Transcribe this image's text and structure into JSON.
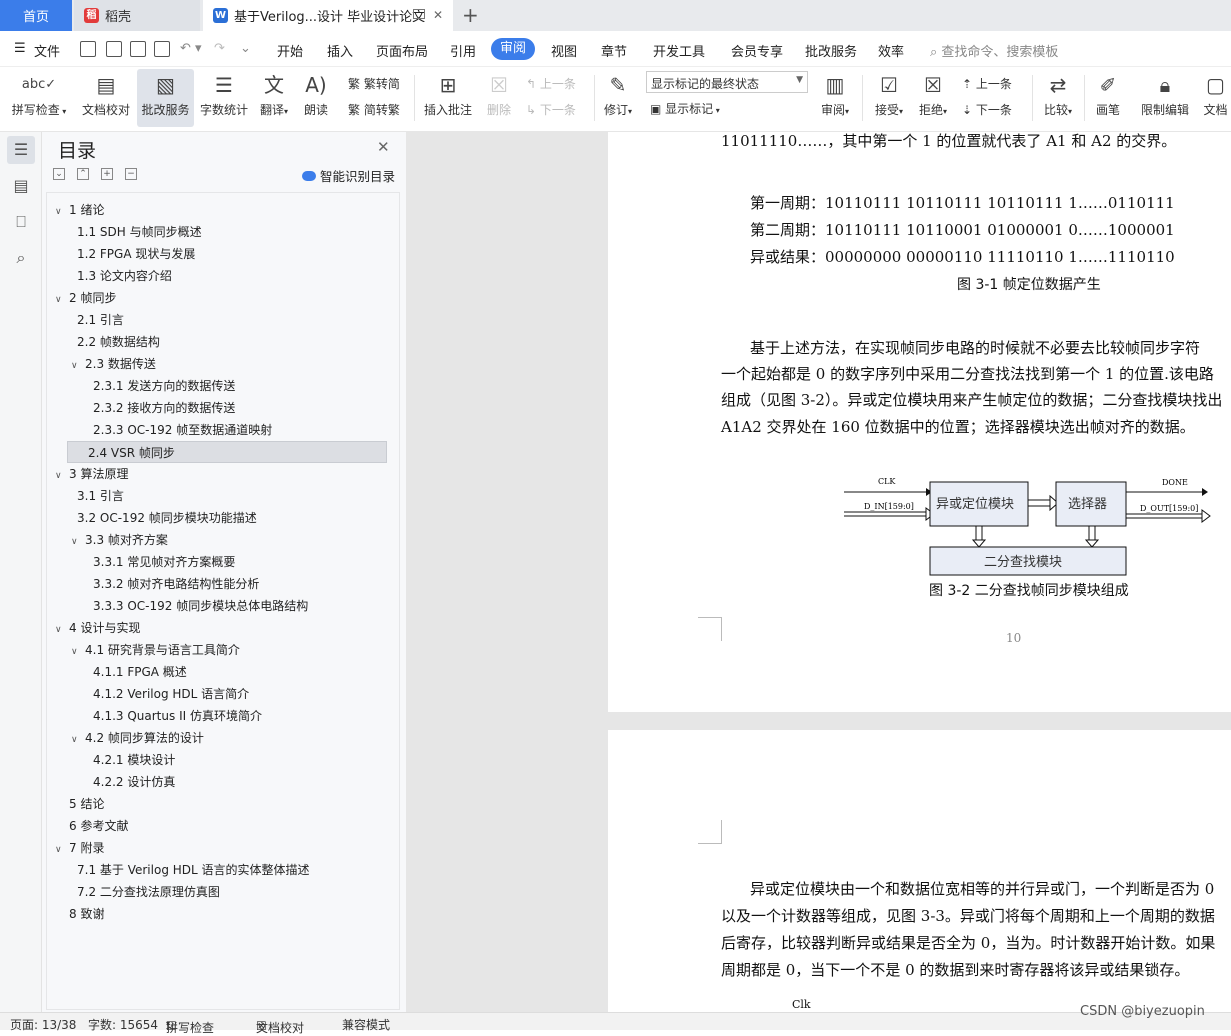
{
  "tabs": {
    "home": "首页",
    "daoke": "稻壳",
    "doc": "基于Verilog...设计 毕业设计论文"
  },
  "menu": {
    "file": "文件",
    "items": [
      "开始",
      "插入",
      "页面布局",
      "引用",
      "审阅",
      "视图",
      "章节",
      "开发工具",
      "会员专享",
      "批改服务",
      "效率"
    ],
    "active": "审阅",
    "search": "查找命令、搜索模板"
  },
  "ribbon": {
    "spell": "拼写检查",
    "proof": "文档校对",
    "correct": "批改服务",
    "wordcount": "字数统计",
    "translate": "翻译",
    "read": "朗读",
    "trad": "繁转简",
    "simp": "简转繁",
    "insert_comment": "插入批注",
    "delete": "删除",
    "prev": "上一条",
    "next": "下一条",
    "revise": "修订",
    "markup_state": "显示标记的最终状态",
    "show_markup": "显示标记",
    "review": "审阅",
    "accept": "接受",
    "reject": "拒绝",
    "prev2": "上一条",
    "next2": "下一条",
    "compare": "比较",
    "pen": "画笔",
    "restrict": "限制编辑",
    "docright": "文档"
  },
  "toc": {
    "title": "目录",
    "smart": "智能识别目录",
    "items": [
      {
        "label": "1  绪论",
        "level": 1,
        "arrow": true
      },
      {
        "label": "1.1 SDH 与帧同步概述",
        "level": 2,
        "arrow": false
      },
      {
        "label": "1.2 FPGA 现状与发展",
        "level": 2,
        "arrow": false
      },
      {
        "label": "1.3  论文内容介绍",
        "level": 2,
        "arrow": false
      },
      {
        "label": "2  帧同步",
        "level": 1,
        "arrow": true
      },
      {
        "label": "2.1  引言",
        "level": 2,
        "arrow": false
      },
      {
        "label": "2.2  帧数据结构",
        "level": 2,
        "arrow": false
      },
      {
        "label": "2.3 数据传送",
        "level": 2,
        "arrow": true
      },
      {
        "label": "2.3.1  发送方向的数据传送",
        "level": 3,
        "arrow": false
      },
      {
        "label": "2.3.2  接收方向的数据传送",
        "level": 3,
        "arrow": false
      },
      {
        "label": "2.3.3 OC-192 帧至数据通道映射",
        "level": 3,
        "arrow": false
      },
      {
        "label": "2.4 VSR 帧同步",
        "level": 2,
        "arrow": false,
        "selected": true
      },
      {
        "label": "3  算法原理",
        "level": 1,
        "arrow": true
      },
      {
        "label": "3.1  引言",
        "level": 2,
        "arrow": false
      },
      {
        "label": "3.2 OC-192 帧同步模块功能描述",
        "level": 2,
        "arrow": false
      },
      {
        "label": "3.3  帧对齐方案",
        "level": 2,
        "arrow": true
      },
      {
        "label": "3.3.1  常见帧对齐方案概要",
        "level": 3,
        "arrow": false
      },
      {
        "label": "3.3.2  帧对齐电路结构性能分析",
        "level": 3,
        "arrow": false
      },
      {
        "label": "3.3.3 OC-192 帧同步模块总体电路结构",
        "level": 3,
        "arrow": false
      },
      {
        "label": "4  设计与实现",
        "level": 1,
        "arrow": true
      },
      {
        "label": "4.1 研究背景与语言工具简介",
        "level": 2,
        "arrow": true
      },
      {
        "label": "4.1.1 FPGA 概述",
        "level": 3,
        "arrow": false
      },
      {
        "label": "4.1.2 Verilog HDL 语言简介",
        "level": 3,
        "arrow": false
      },
      {
        "label": "4.1.3 Quartus II 仿真环境简介",
        "level": 3,
        "arrow": false
      },
      {
        "label": "4.2  帧同步算法的设计",
        "level": 2,
        "arrow": true
      },
      {
        "label": "4.2.1  模块设计",
        "level": 3,
        "arrow": false
      },
      {
        "label": "4.2.2  设计仿真",
        "level": 3,
        "arrow": false
      },
      {
        "label": "5  结论",
        "level": 1,
        "arrow": false
      },
      {
        "label": "6  参考文献",
        "level": 1,
        "arrow": false
      },
      {
        "label": "7  附录",
        "level": 1,
        "arrow": true
      },
      {
        "label": "7.1  基于 Verilog HDL 语言的实体整体描述",
        "level": 2,
        "arrow": false
      },
      {
        "label": "7.2  二分查找法原理仿真图",
        "level": 2,
        "arrow": false
      },
      {
        "label": "8  致谢",
        "level": 1,
        "arrow": false
      }
    ]
  },
  "doc": {
    "line0": "11011110……，其中第一个 1 的位置就代表了 A1 和 A2 的交界。",
    "period1": "第一周期：10110111 10110111 10110111 1……0110111",
    "period2": "第二周期：10110111 10110001 01000001 0……1000001",
    "xor": "异或结果：00000000 00000110 11110110 1……1110110",
    "fig31": "图 3-1  帧定位数据产生",
    "para1": "基于上述方法，在实现帧同步电路的时候就不必要去比较帧同步字符",
    "para2": "一个起始都是 0 的数字序列中采用二分查找法找到第一个 1 的位置.该电路",
    "para3": "组成（见图 3-2）。异或定位模块用来产生帧定位的数据；二分查找模块找出",
    "para4": "A1A2 交界处在 160 位数据中的位置；选择器模块选出帧对齐的数据。",
    "diagram": {
      "clk": "CLK",
      "din": "D_IN[159:0]",
      "xor_block": "异或定位模块",
      "selector": "选择器",
      "done": "DONE",
      "dout": "D_OUT[159:0]",
      "binsearch": "二分查找模块"
    },
    "fig32": "图 3-2  二分查找帧同步模块组成",
    "pagenum": "10",
    "p2line1": "异或定位模块由一个和数据位宽相等的并行异或门，一个判断是否为 0",
    "p2line2": "以及一个计数器等组成，见图 3-3。异或门将每个周期和上一个周期的数据",
    "p2line3": "后寄存，比较器判断异或结果是否全为 0，当为。时计数器开始计数。如果",
    "p2line4": "周期都是 0，当下一个不是 0 的数据到来时寄存器将该异或结果锁存。",
    "p2clk": "Clk"
  },
  "status": {
    "page": "页面: 13/38",
    "words": "字数: 15654",
    "spell": "拼写检查",
    "proof": "文档校对",
    "compat": "兼容模式"
  },
  "watermark": "CSDN @biyezuopin"
}
